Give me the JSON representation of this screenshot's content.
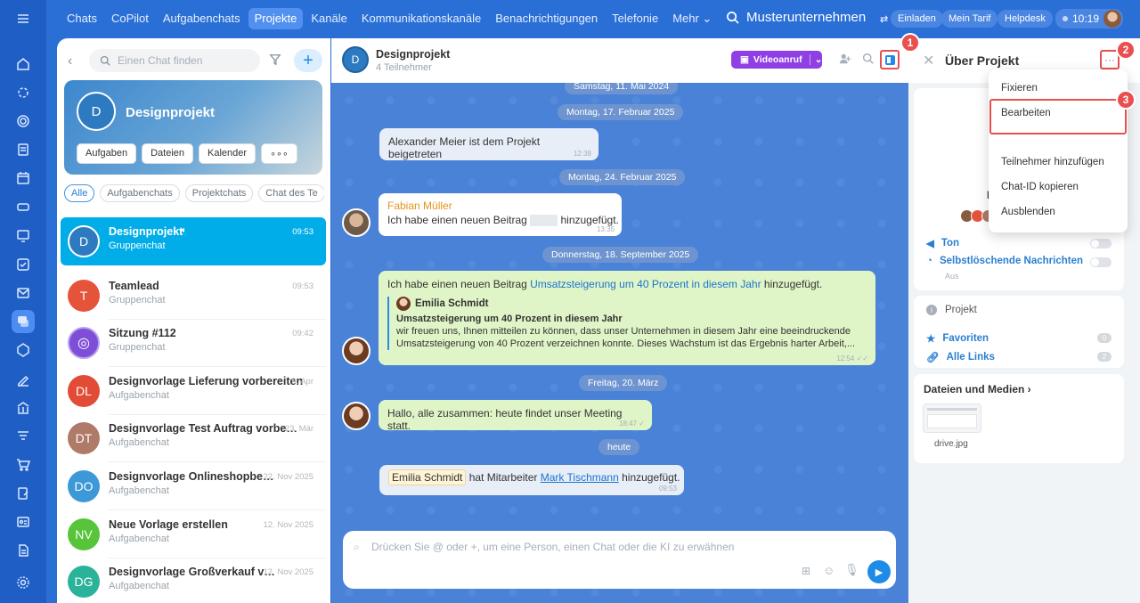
{
  "rail": {
    "items": [
      "menu",
      "home",
      "hub",
      "target",
      "doc",
      "calendar",
      "drive",
      "board",
      "check",
      "mail",
      "chat",
      "puzzle",
      "sign",
      "bank",
      "filter",
      "cart",
      "edit",
      "id",
      "file",
      "gear"
    ]
  },
  "nav": {
    "items": [
      "Chats",
      "CoPilot",
      "Aufgabenchats",
      "Projekte",
      "Kanäle",
      "Kommunikationskanäle",
      "Benachrichtigungen",
      "Telefonie",
      "Mehr ⌄"
    ],
    "active": "Projekte"
  },
  "company": "Musterunternehmen",
  "header": {
    "invite": "Einladen",
    "plan": "Mein Tarif",
    "helpdesk": "Helpdesk",
    "time": "10:19"
  },
  "search": {
    "placeholder": "Einen Chat finden"
  },
  "card": {
    "initial": "D",
    "title": "Designprojekt",
    "buttons": [
      "Aufgaben",
      "Dateien",
      "Kalender",
      "∘∘∘"
    ]
  },
  "tabs": [
    "Alle",
    "Aufgabenchats",
    "Projektchats",
    "Chat des Te"
  ],
  "chats": [
    {
      "initial": "D",
      "name": "Designprojekt",
      "sub": "Gruppenchat",
      "time": "09:53",
      "color": "#1b7fc8"
    },
    {
      "initial": "T",
      "name": "Teamlead",
      "sub": "Gruppenchat",
      "time": "09:53",
      "color": "#e5533a"
    },
    {
      "initial": "",
      "name": "Sitzung #112",
      "sub": "Gruppenchat",
      "time": "09:42",
      "color": "#7e4fd6"
    },
    {
      "initial": "DL",
      "name": "Designvorlage Lieferung vorbereiten",
      "sub": "Aufgabenchat",
      "time": "9. Apr",
      "color": "#e24b35"
    },
    {
      "initial": "DT",
      "name": "Designvorlage Test Auftrag vorbe…",
      "sub": "Aufgabenchat",
      "time": "23. Mär",
      "color": "#b07a68"
    },
    {
      "initial": "DO",
      "name": "Designvorlage Onlineshopbe…",
      "sub": "Aufgabenchat",
      "time": "22. Nov 2025",
      "color": "#3c98d6"
    },
    {
      "initial": "NV",
      "name": "Neue Vorlage erstellen",
      "sub": "Aufgabenchat",
      "time": "12. Nov 2025",
      "color": "#57c43a"
    },
    {
      "initial": "DG",
      "name": "Designvorlage Großverkauf v…",
      "sub": "Aufgabenchat",
      "time": "12. Nov 2025",
      "color": "#2bb39a"
    }
  ],
  "chat": {
    "title": "Designprojekt",
    "members": "4 Teilnehmer",
    "video": "Videoanruf",
    "dates": [
      "Samstag, 11. Mai 2024",
      "Montag, 17. Februar 2025",
      "Montag, 24. Februar 2025",
      "Donnerstag, 18. September 2025",
      "Freitag, 20. März",
      "heute"
    ],
    "m1": {
      "text": "Alexander Meier ist dem Projekt beigetreten",
      "time": "12:38"
    },
    "m2": {
      "author": "Fabian Müller",
      "pre": "Ich habe einen neuen Beitrag",
      "post": "hinzugefügt.",
      "time": "13:35"
    },
    "m3": {
      "pre": "Ich habe einen neuen Beitrag ",
      "link": "Umsatzsteigerung um 40 Prozent in diesem Jahr",
      "post": " hinzugefügt.",
      "qauthor": "Emilia Schmidt",
      "qtitle": "Umsatzsteigerung um 40 Prozent in diesem Jahr",
      "qtext": "wir freuen uns, Ihnen mitteilen zu können, dass unser Unternehmen in diesem Jahr eine beeindruckende Umsatzsteigerung von 40 Prozent verzeichnen konnte. Dieses Wachstum ist das Ergebnis harter Arbeit,...",
      "time": "12:54 ✓✓"
    },
    "m4": {
      "text": "Hallo, alle zusammen: heute findet unser Meeting statt.",
      "time": "18:47 ✓"
    },
    "m5": {
      "name1": "Emilia Schmidt",
      "mid": " hat Mitarbeiter ",
      "name2": "Mark Tischmann",
      "post": " hinzugefügt.",
      "time": "09:53"
    },
    "input_placeholder": "Drücken Sie @ oder +, um eine Person, einen Chat oder die KI zu erwähnen"
  },
  "panel": {
    "title": "Über Projekt",
    "letter": "D",
    "sound": "Ton",
    "autodelete": "Selbstlöschende Nachrichten",
    "autodelete_value": "Aus",
    "project": "Projekt",
    "favorites": "Favoriten",
    "favorites_count": "0",
    "links": "Alle Links",
    "links_count": "2",
    "files": "Dateien und Medien ›",
    "file_name": "drive.jpg"
  },
  "menu": [
    "Fixieren",
    "Bearbeiten",
    "Teilnehmer hinzufügen",
    "Chat-ID kopieren",
    "Ausblenden"
  ],
  "badges": [
    "1",
    "2",
    "3"
  ],
  "colors": {
    "accent": "#1e8be8",
    "highlight": "#ea4f4f",
    "video": "#8f3fe3",
    "selected": "#00ade8"
  }
}
